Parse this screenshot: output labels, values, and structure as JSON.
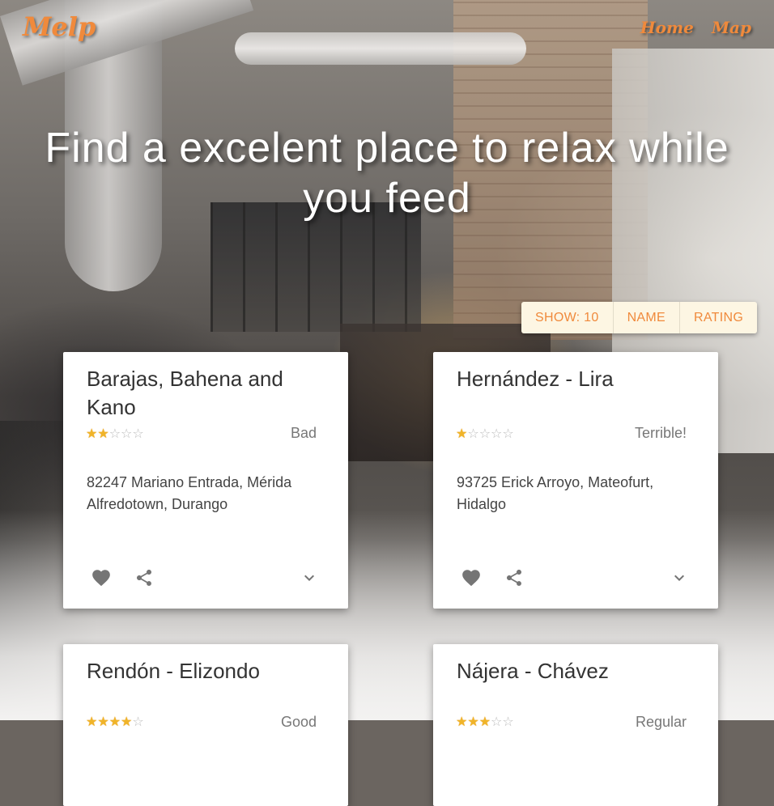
{
  "header": {
    "logo": "Melp",
    "nav": [
      {
        "label": "Home"
      },
      {
        "label": "Map"
      }
    ]
  },
  "hero": {
    "title": "Find a excelent place to relax while you feed"
  },
  "filters": {
    "show": "SHOW: 10",
    "name": "NAME",
    "rating": "RATING"
  },
  "cards": [
    {
      "name": "Barajas, Bahena and Kano",
      "rating": 2,
      "max_rating": 5,
      "rating_text": "Bad",
      "address": "82247 Mariano Entrada, Mérida Alfredotown, Durango"
    },
    {
      "name": "Hernández - Lira",
      "rating": 1,
      "max_rating": 5,
      "rating_text": "Terrible!",
      "address": "93725 Erick Arroyo, Mateofurt, Hidalgo"
    },
    {
      "name": "Rendón - Elizondo",
      "rating": 4,
      "max_rating": 5,
      "rating_text": "Good",
      "address": ""
    },
    {
      "name": "Nájera - Chávez",
      "rating": 3,
      "max_rating": 5,
      "rating_text": "Regular",
      "address": ""
    }
  ],
  "colors": {
    "accent": "#f08a3c",
    "star": "#f0b429",
    "icon": "#757575"
  },
  "icons": {
    "favorite": "heart-icon",
    "share": "share-icon",
    "expand": "chevron-down-icon"
  }
}
